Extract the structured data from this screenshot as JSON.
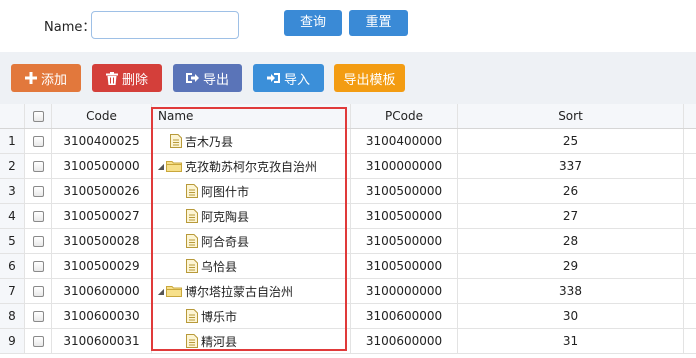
{
  "search": {
    "name_label": "Name：",
    "name_value": "",
    "query_label": "查询",
    "reset_label": "重置"
  },
  "toolbar": {
    "add_label": "添加",
    "delete_label": "删除",
    "export_label": "导出",
    "import_label": "导入",
    "template_label": "导出模板"
  },
  "colors": {
    "accent": "#3a8ad6",
    "add": "#e2783c",
    "delete": "#d43f3a",
    "export": "#5a74b8",
    "import": "#3b8fd9",
    "template": "#f39c12",
    "highlight": "#e03a3a"
  },
  "grid": {
    "columns": [
      "Code",
      "Name",
      "PCode",
      "Sort"
    ],
    "rows": [
      {
        "num": "1",
        "code": "3100400025",
        "name": "吉木乃县",
        "pcode": "3100400000",
        "sort": "25",
        "type": "file",
        "level": 1,
        "expanded": false
      },
      {
        "num": "2",
        "code": "3100500000",
        "name": "克孜勒苏柯尔克孜自治州",
        "pcode": "3100000000",
        "sort": "337",
        "type": "folder",
        "level": 0,
        "expanded": true
      },
      {
        "num": "3",
        "code": "3100500026",
        "name": "阿图什市",
        "pcode": "3100500000",
        "sort": "26",
        "type": "file",
        "level": 2,
        "expanded": false
      },
      {
        "num": "4",
        "code": "3100500027",
        "name": "阿克陶县",
        "pcode": "3100500000",
        "sort": "27",
        "type": "file",
        "level": 2,
        "expanded": false
      },
      {
        "num": "5",
        "code": "3100500028",
        "name": "阿合奇县",
        "pcode": "3100500000",
        "sort": "28",
        "type": "file",
        "level": 2,
        "expanded": false
      },
      {
        "num": "6",
        "code": "3100500029",
        "name": "乌恰县",
        "pcode": "3100500000",
        "sort": "29",
        "type": "file",
        "level": 2,
        "expanded": false
      },
      {
        "num": "7",
        "code": "3100600000",
        "name": "博尔塔拉蒙古自治州",
        "pcode": "3100000000",
        "sort": "338",
        "type": "folder",
        "level": 0,
        "expanded": true
      },
      {
        "num": "8",
        "code": "3100600030",
        "name": "博乐市",
        "pcode": "3100600000",
        "sort": "30",
        "type": "file",
        "level": 2,
        "expanded": false
      },
      {
        "num": "9",
        "code": "3100600031",
        "name": "精河县",
        "pcode": "3100600000",
        "sort": "31",
        "type": "file",
        "level": 2,
        "expanded": false
      }
    ]
  }
}
